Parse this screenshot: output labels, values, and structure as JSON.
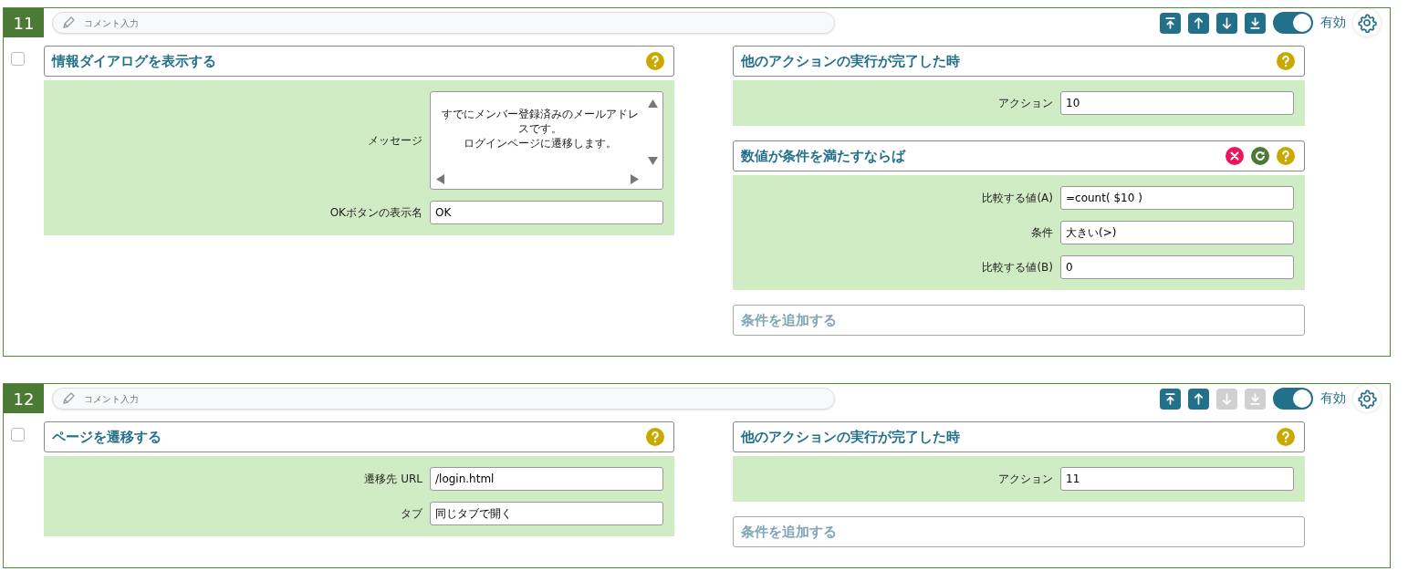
{
  "steps": [
    {
      "number": "11",
      "comment_placeholder": "コメント入力",
      "checked": false,
      "enabled": true,
      "enabled_label": "有効",
      "move_buttons": [
        {
          "kind": "top",
          "disabled": false
        },
        {
          "kind": "up",
          "disabled": false
        },
        {
          "kind": "down",
          "disabled": false
        },
        {
          "kind": "bottom",
          "disabled": false
        }
      ],
      "action": {
        "title": "情報ダイアログを表示する",
        "icons": [
          {
            "kind": "help"
          }
        ],
        "fields": [
          {
            "kind": "textarea",
            "label": "メッセージ",
            "lines": [
              "すでにメンバー登録済みのメールアドレスです。",
              "ログインページに遷移します。"
            ]
          },
          {
            "kind": "text",
            "label": "OKボタンの表示名",
            "value": "OK"
          }
        ]
      },
      "triggers": [
        {
          "title": "他のアクションの実行が完了した時",
          "icons": [
            {
              "kind": "help"
            }
          ],
          "fields": [
            {
              "kind": "text",
              "label": "アクション",
              "value": "10"
            }
          ]
        },
        {
          "title": "数値が条件を満たすならば",
          "icons": [
            {
              "kind": "remove"
            },
            {
              "kind": "reset"
            },
            {
              "kind": "help"
            }
          ],
          "fields": [
            {
              "kind": "text",
              "label": "比較する値(A)",
              "value": "=count( $10 )"
            },
            {
              "kind": "text",
              "label": "条件",
              "value": "大きい(>)"
            },
            {
              "kind": "text",
              "label": "比較する値(B)",
              "value": "0"
            }
          ]
        }
      ],
      "add_condition": "条件を追加する"
    },
    {
      "number": "12",
      "comment_placeholder": "コメント入力",
      "checked": false,
      "enabled": true,
      "enabled_label": "有効",
      "move_buttons": [
        {
          "kind": "top",
          "disabled": false
        },
        {
          "kind": "up",
          "disabled": false
        },
        {
          "kind": "down",
          "disabled": true
        },
        {
          "kind": "bottom",
          "disabled": true
        }
      ],
      "action": {
        "title": "ページを遷移する",
        "icons": [
          {
            "kind": "help"
          }
        ],
        "fields": [
          {
            "kind": "text",
            "label": "遷移先 URL",
            "value": "/login.html"
          },
          {
            "kind": "text",
            "label": "タブ",
            "value": "同じタブで開く"
          }
        ]
      },
      "triggers": [
        {
          "title": "他のアクションの実行が完了した時",
          "icons": [
            {
              "kind": "help"
            }
          ],
          "fields": [
            {
              "kind": "text",
              "label": "アクション",
              "value": "11"
            }
          ]
        }
      ],
      "add_condition": "条件を追加する"
    }
  ]
}
